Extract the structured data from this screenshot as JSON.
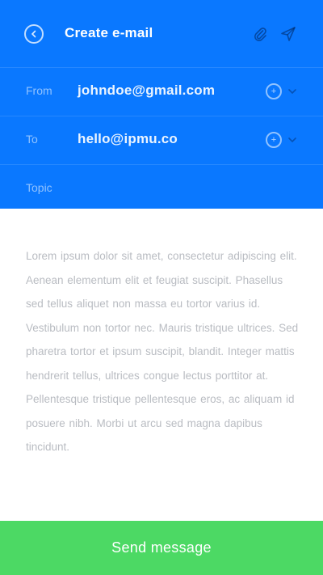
{
  "header": {
    "title": "Create e-mail",
    "back_icon": "back-icon",
    "attach_icon": "paperclip-icon",
    "send_icon": "send-icon"
  },
  "fields": {
    "from": {
      "label": "From",
      "value": "johndoe@gmail.com"
    },
    "to": {
      "label": "To",
      "value": "hello@ipmu.co"
    },
    "topic": {
      "label": "Topic",
      "value": ""
    }
  },
  "message": {
    "text": "Lorem ipsum dolor sit amet, consectetur adipiscing elit. Aenean elementum elit et feugiat suscipit. Phasellus sed tellus aliquet non massa eu tortor varius id. Vestibulum non tortor nec. Mauris tristique ultrices. Sed pharetra tortor et ipsum suscipit, blandit. Integer mattis hendrerit tellus, ultrices congue lectus porttitor at. Pellentesque tristique pellentesque eros, ac aliquam id posuere nibh. Morbi ut arcu sed magna dapibus tincidunt."
  },
  "actions": {
    "send_label": "Send message"
  },
  "colors": {
    "header_bg": "#0a78ff",
    "send_bg": "#4cd964",
    "body_text": "#b9bcc2"
  }
}
